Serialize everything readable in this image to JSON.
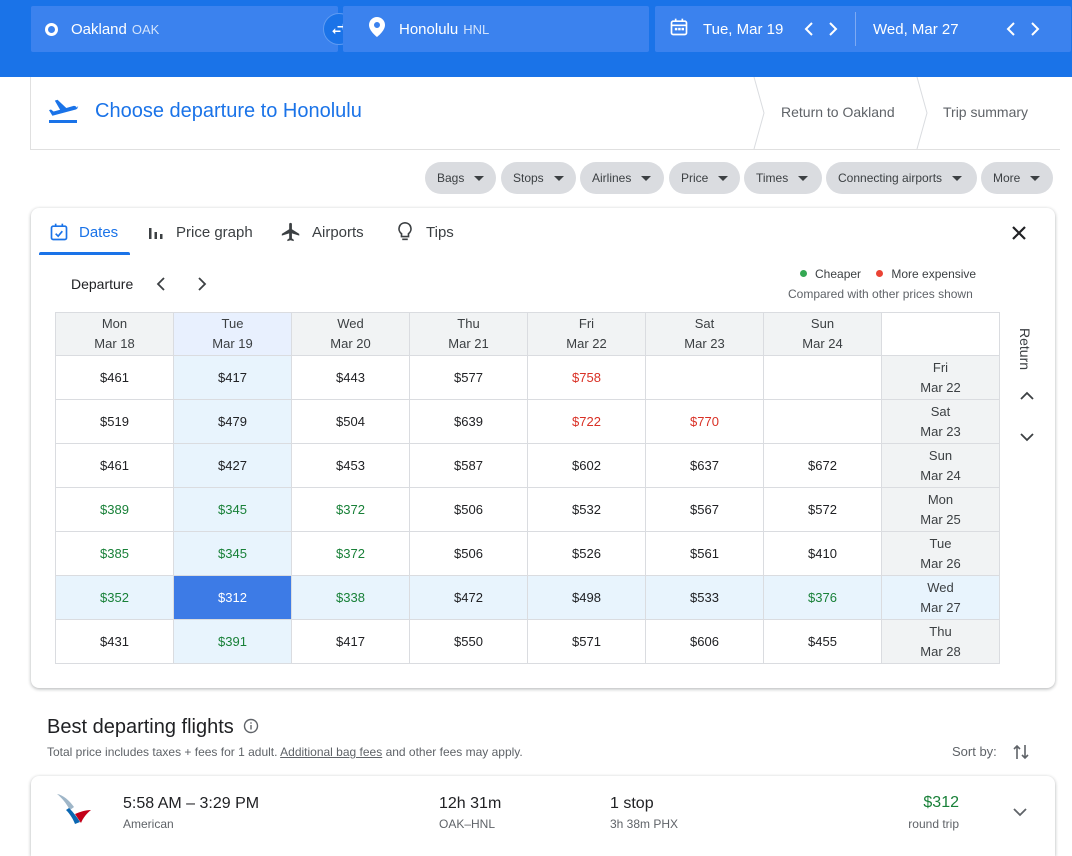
{
  "search": {
    "origin_city": "Oakland",
    "origin_code": "OAK",
    "dest_city": "Honolulu",
    "dest_code": "HNL",
    "depart_date": "Tue, Mar 19",
    "return_date": "Wed, Mar 27"
  },
  "header": {
    "title": "Choose departure to Honolulu",
    "step_return": "Return to Oakland",
    "step_summary": "Trip summary"
  },
  "filters": [
    "Bags",
    "Stops",
    "Airlines",
    "Price",
    "Times",
    "Connecting airports",
    "More"
  ],
  "tabs": [
    "Dates",
    "Price graph",
    "Airports",
    "Tips"
  ],
  "grid": {
    "departure_label": "Departure",
    "return_label": "Return",
    "legend_cheaper": "Cheaper",
    "legend_expensive": "More expensive",
    "legend_sub": "Compared with other prices shown",
    "colors": {
      "cheaper": "#188038",
      "expensive": "#d93025",
      "selected": "#3d7be6"
    },
    "columns": [
      {
        "day": "Mon",
        "date": "Mar 18"
      },
      {
        "day": "Tue",
        "date": "Mar 19"
      },
      {
        "day": "Wed",
        "date": "Mar 20"
      },
      {
        "day": "Thu",
        "date": "Mar 21"
      },
      {
        "day": "Fri",
        "date": "Mar 22"
      },
      {
        "day": "Sat",
        "date": "Mar 23"
      },
      {
        "day": "Sun",
        "date": "Mar 24"
      }
    ],
    "rows": [
      {
        "day": "Fri",
        "date": "Mar 22",
        "prices": [
          "$461",
          "$417",
          "$443",
          "$577",
          "$758",
          "",
          ""
        ],
        "status": [
          "n",
          "n",
          "n",
          "n",
          "e",
          "n",
          "n"
        ]
      },
      {
        "day": "Sat",
        "date": "Mar 23",
        "prices": [
          "$519",
          "$479",
          "$504",
          "$639",
          "$722",
          "$770",
          ""
        ],
        "status": [
          "n",
          "n",
          "n",
          "n",
          "e",
          "e",
          "n"
        ]
      },
      {
        "day": "Sun",
        "date": "Mar 24",
        "prices": [
          "$461",
          "$427",
          "$453",
          "$587",
          "$602",
          "$637",
          "$672"
        ],
        "status": [
          "n",
          "n",
          "n",
          "n",
          "n",
          "n",
          "n"
        ]
      },
      {
        "day": "Mon",
        "date": "Mar 25",
        "prices": [
          "$389",
          "$345",
          "$372",
          "$506",
          "$532",
          "$567",
          "$572"
        ],
        "status": [
          "c",
          "c",
          "c",
          "n",
          "n",
          "n",
          "n"
        ]
      },
      {
        "day": "Tue",
        "date": "Mar 26",
        "prices": [
          "$385",
          "$345",
          "$372",
          "$506",
          "$526",
          "$561",
          "$410"
        ],
        "status": [
          "c",
          "c",
          "c",
          "n",
          "n",
          "n",
          "n"
        ]
      },
      {
        "day": "Wed",
        "date": "Mar 27",
        "prices": [
          "$352",
          "$312",
          "$338",
          "$472",
          "$498",
          "$533",
          "$376"
        ],
        "status": [
          "c",
          "s",
          "c",
          "n",
          "n",
          "n",
          "c"
        ]
      },
      {
        "day": "Thu",
        "date": "Mar 28",
        "prices": [
          "$431",
          "$391",
          "$417",
          "$550",
          "$571",
          "$606",
          "$455"
        ],
        "status": [
          "n",
          "c",
          "n",
          "n",
          "n",
          "n",
          "n"
        ]
      }
    ]
  },
  "best": {
    "title": "Best departing flights",
    "sub_pre": "Total price includes taxes + fees for 1 adult.",
    "sub_link": "Additional bag fees",
    "sub_post": "and other fees may apply.",
    "sort_by": "Sort by:"
  },
  "flight": {
    "times": "5:58 AM – 3:29 PM",
    "airline": "American",
    "duration": "12h 31m",
    "route": "OAK–HNL",
    "stops": "1 stop",
    "layover": "3h 38m PHX",
    "price": "$312",
    "price_type": "round trip"
  }
}
